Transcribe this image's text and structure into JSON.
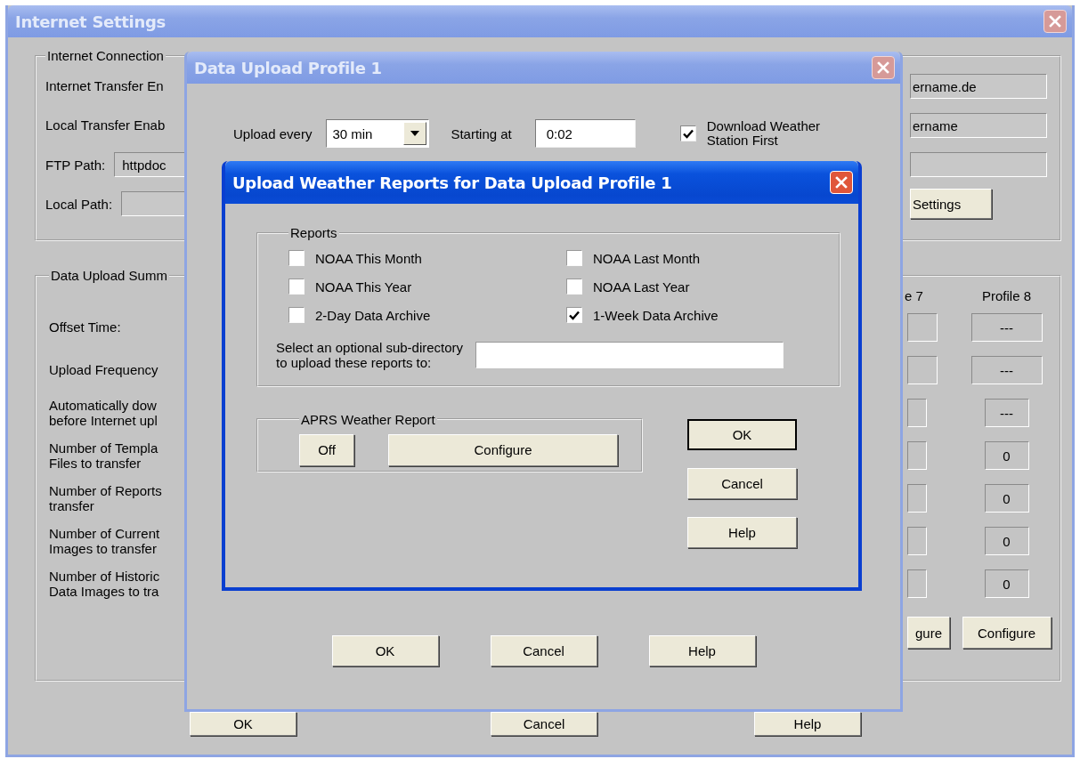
{
  "main_window": {
    "title": "Internet Settings",
    "connection_group": {
      "title": "Internet Connection",
      "rows": [
        {
          "kind": "label",
          "label": "Internet Transfer En",
          "right": {
            "kind": "field",
            "value": "ername.de"
          }
        },
        {
          "kind": "label",
          "label": "Local Transfer Enab",
          "right": {
            "kind": "field",
            "value": "ername"
          }
        },
        {
          "kind": "label_field",
          "label": "FTP Path:",
          "value": "httpdoc",
          "right": {
            "kind": "field"
          }
        },
        {
          "kind": "label_field",
          "label": "Local Path:",
          "right": {
            "kind": "button",
            "label": "Settings"
          }
        }
      ]
    },
    "summary_group": {
      "title": "Data Upload Summ",
      "columns": [
        "e 7",
        "Profile 8"
      ],
      "rows": [
        {
          "kind": "wide",
          "label": "Offset Time:",
          "profile_8": "---"
        },
        {
          "kind": "wide",
          "label": "Upload Frequency",
          "profile_8": "---"
        },
        {
          "kind": "narrow",
          "label": "Automatically dow\nbefore Internet upl",
          "profile_8": "---"
        },
        {
          "kind": "narrow",
          "label": "Number of Templa\nFiles to transfer",
          "profile_8": "0"
        },
        {
          "kind": "narrow",
          "label": "Number of Reports\ntransfer",
          "profile_8": "0"
        },
        {
          "kind": "narrow",
          "label": "Number of Current\nImages to transfer",
          "profile_8": "0"
        },
        {
          "kind": "narrow",
          "label": "Number of Historic\nData Images to tra",
          "profile_8": "0"
        }
      ],
      "buttons": [
        "gure",
        "Configure"
      ]
    },
    "buttons": [
      "OK",
      "Cancel",
      "Help"
    ]
  },
  "profile_window": {
    "title": "Data Upload Profile 1",
    "upload_every": {
      "label": "Upload every",
      "value": "30 min"
    },
    "starting_at": {
      "label": "Starting at",
      "value": "0:02"
    },
    "download_first": {
      "label": "Download Weather\nStation First",
      "checked": true
    },
    "buttons": [
      "OK",
      "Cancel",
      "Help"
    ]
  },
  "reports_dialog": {
    "title": "Upload Weather Reports for Data Upload Profile 1",
    "reports_group": {
      "title": "Reports",
      "items": [
        {
          "label": "NOAA This Month",
          "checked": false
        },
        {
          "label": "NOAA Last Month",
          "checked": false
        },
        {
          "label": "NOAA This Year",
          "checked": false
        },
        {
          "label": "NOAA Last Year",
          "checked": false
        },
        {
          "label": "2-Day Data Archive",
          "checked": false
        },
        {
          "label": "1-Week Data Archive",
          "checked": true
        }
      ],
      "subdirectory_label": "Select an optional sub-directory\nto upload these reports to:"
    },
    "aprs_group": {
      "title": "APRS Weather Report",
      "buttons": [
        "Off",
        "Configure"
      ]
    },
    "buttons": [
      {
        "label": "OK",
        "default": true
      },
      {
        "label": "Cancel",
        "default": false
      },
      {
        "label": "Help",
        "default": false
      }
    ]
  }
}
